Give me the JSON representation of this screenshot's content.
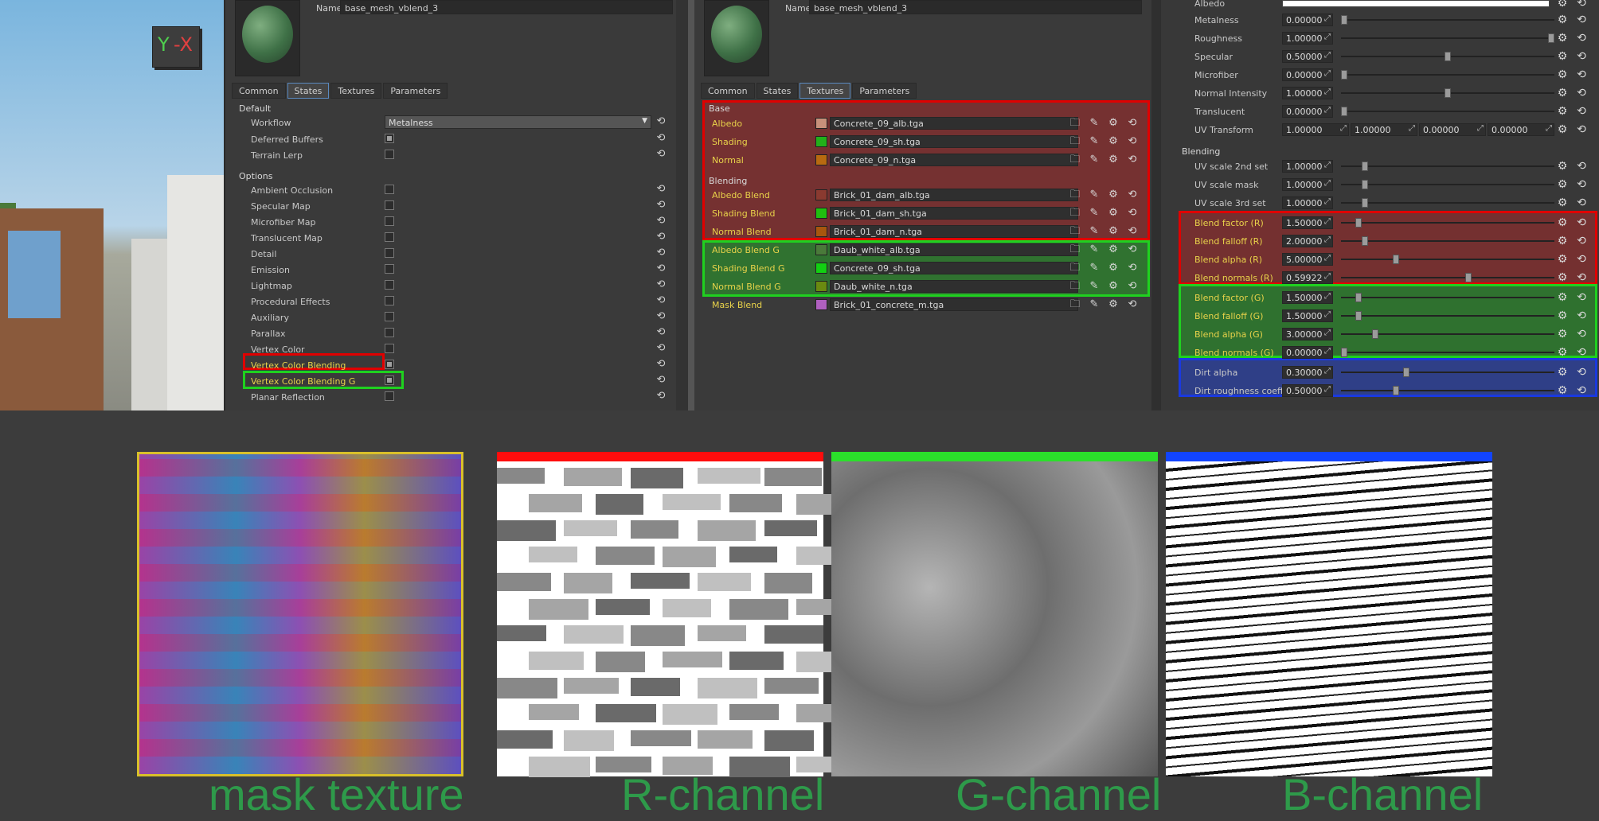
{
  "axis_cube": {
    "y": "Y",
    "x": "-X"
  },
  "panel_states": {
    "name_label": "Name",
    "name_value": "base_mesh_vblend_3",
    "tabs": [
      "Common",
      "States",
      "Textures",
      "Parameters"
    ],
    "default_header": "Default",
    "workflow_label": "Workflow",
    "workflow_value": "Metalness",
    "deferred_label": "Deferred Buffers",
    "terrain_label": "Terrain Lerp",
    "options_header": "Options",
    "options": [
      "Ambient Occlusion",
      "Specular Map",
      "Microfiber Map",
      "Translucent Map",
      "Detail",
      "Emission",
      "Lightmap",
      "Procedural Effects",
      "Auxiliary",
      "Parallax",
      "Vertex Color",
      "Vertex Color Blending",
      "Vertex Color Blending G",
      "Planar Reflection"
    ]
  },
  "panel_textures": {
    "name_label": "Name",
    "name_value": "base_mesh_vblend_3",
    "tabs": [
      "Common",
      "States",
      "Textures",
      "Parameters"
    ],
    "base_header": "Base",
    "blending_header": "Blending",
    "base": [
      {
        "label": "Albedo",
        "file": "Concrete_09_alb.tga",
        "color": "#c8907a"
      },
      {
        "label": "Shading",
        "file": "Concrete_09_sh.tga",
        "color": "#22b01a"
      },
      {
        "label": "Normal",
        "file": "Concrete_09_n.tga",
        "color": "#b86a10"
      }
    ],
    "blending": [
      {
        "label": "Albedo Blend",
        "file": "Brick_01_dam_alb.tga",
        "color": "#8a3a30"
      },
      {
        "label": "Shading Blend",
        "file": "Brick_01_dam_sh.tga",
        "color": "#20c010"
      },
      {
        "label": "Normal Blend",
        "file": "Brick_01_dam_n.tga",
        "color": "#a8560e"
      },
      {
        "label": "Albedo Blend G",
        "file": "Daub_white_alb.tga",
        "color": "#4a7a3a"
      },
      {
        "label": "Shading Blend G",
        "file": "Concrete_09_sh.tga",
        "color": "#12d012"
      },
      {
        "label": "Normal Blend G",
        "file": "Daub_white_n.tga",
        "color": "#6a8a10"
      },
      {
        "label": "Mask Blend",
        "file": "Brick_01_concrete_m.tga",
        "color": "#b060c0"
      }
    ]
  },
  "panel_parameters": {
    "albedo_label": "Albedo",
    "rows": [
      {
        "label": "Metalness",
        "value": "0.00000",
        "pos": 0.0
      },
      {
        "label": "Roughness",
        "value": "1.00000",
        "pos": 1.0
      },
      {
        "label": "Specular",
        "value": "0.50000",
        "pos": 0.5
      },
      {
        "label": "Microfiber",
        "value": "0.00000",
        "pos": 0.0
      },
      {
        "label": "Normal Intensity",
        "value": "1.00000",
        "pos": 0.5
      },
      {
        "label": "Translucent",
        "value": "0.00000",
        "pos": 0.0
      }
    ],
    "uv_transform": {
      "label": "UV Transform",
      "values": [
        "1.00000",
        "1.00000",
        "0.00000",
        "0.00000"
      ]
    },
    "blending_header": "Blending",
    "blend_rows": [
      {
        "label": "UV scale 2nd set",
        "value": "1.00000",
        "pos": 0.1
      },
      {
        "label": "UV scale mask",
        "value": "1.00000",
        "pos": 0.1
      },
      {
        "label": "UV scale 3rd set",
        "value": "1.00000",
        "pos": 0.1
      },
      {
        "label": "Blend factor (R)",
        "value": "1.50000",
        "pos": 0.07
      },
      {
        "label": "Blend falloff (R)",
        "value": "2.00000",
        "pos": 0.1
      },
      {
        "label": "Blend alpha (R)",
        "value": "5.00000",
        "pos": 0.25
      },
      {
        "label": "Blend normals (R)",
        "value": "0.59922",
        "pos": 0.6
      },
      {
        "label": "Blend factor (G)",
        "value": "1.50000",
        "pos": 0.07
      },
      {
        "label": "Blend falloff (G)",
        "value": "1.50000",
        "pos": 0.07
      },
      {
        "label": "Blend alpha (G)",
        "value": "3.00000",
        "pos": 0.15
      },
      {
        "label": "Blend normals (G)",
        "value": "0.00000",
        "pos": 0.0
      },
      {
        "label": "Dirt alpha",
        "value": "0.30000",
        "pos": 0.3
      },
      {
        "label": "Dirt roughness coeff",
        "value": "0.50000",
        "pos": 0.25
      }
    ]
  },
  "captions": {
    "mask": "mask texture",
    "r": "R-channel",
    "g": "G-channel",
    "b": "B-channel"
  },
  "colors": {
    "red_box": "#e00000",
    "green_box": "#1fd11f",
    "blue_box": "#1a39e0",
    "caption": "#2e9a4a",
    "label_yellow": "#e8d24a"
  }
}
